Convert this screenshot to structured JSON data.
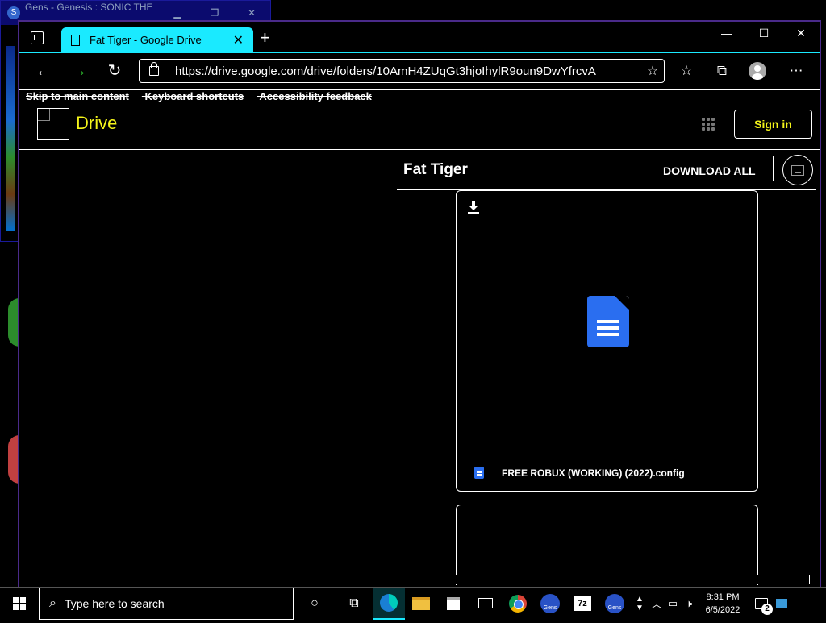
{
  "gens_window": {
    "title": "Gens - Genesis : SONIC THE ...",
    "minimize": "▁",
    "restore": "❐",
    "close": "✕"
  },
  "browser": {
    "tab_title": "Fat Tiger - Google Drive",
    "tab_close": "✕",
    "new_tab": "+",
    "window_minimize": "—",
    "window_maximize": "☐",
    "window_close": "✕",
    "url": "https://drive.google.com/drive/folders/10AmH4ZUqGt3hjoIhylR9oun9DwYfrcvA",
    "back": "←",
    "forward": "→",
    "reload": "↻",
    "favorites_add": "☆",
    "favorites": "☆",
    "collections": "⧉",
    "more": "⋯"
  },
  "page": {
    "skip_links": [
      "Skip to main content",
      "Keyboard shortcuts",
      "Accessibility feedback"
    ],
    "app_name": "Drive",
    "sign_in": "Sign in",
    "folder_title": "Fat Tiger",
    "download_all": "DOWNLOAD ALL",
    "files": [
      {
        "name": "FREE ROBUX (WORKING) (2022).config"
      }
    ]
  },
  "taskbar": {
    "search_placeholder": "Type here to search",
    "cortana": "○",
    "task_view": "⧉",
    "zip_label": "7z",
    "gens_label": "Gens",
    "time": "8:31 PM",
    "date": "6/5/2022",
    "notification_count": "2",
    "tray_up": "︿",
    "network": "▭",
    "volume": "🕨"
  },
  "colors": {
    "accent": "#1aeaff",
    "brand_text": "#f4f41a",
    "doc_blue": "#2a6ef0"
  }
}
